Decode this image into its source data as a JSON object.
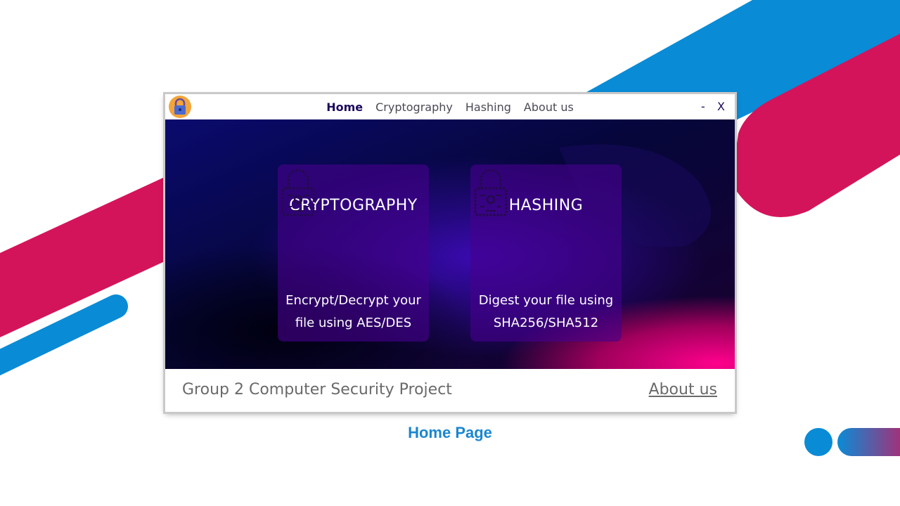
{
  "nav": {
    "items": [
      {
        "label": "Home",
        "active": true
      },
      {
        "label": "Cryptography",
        "active": false
      },
      {
        "label": "Hashing",
        "active": false
      },
      {
        "label": "About us",
        "active": false
      }
    ]
  },
  "window_controls": {
    "minimize": "-",
    "close": "X"
  },
  "app_icon": "lock-icon",
  "cards": [
    {
      "title": "CRYPTOGRAPHY",
      "icon": "padlock-icon",
      "description": "Encrypt/Decrypt your file using AES/DES"
    },
    {
      "title": "HASHING",
      "icon": "padlock-icon",
      "description": "Digest your file using SHA256/SHA512"
    }
  ],
  "footer": {
    "title": "Group 2 Computer Security Project",
    "link": "About us"
  },
  "caption": "Home Page",
  "colors": {
    "accent_blue": "#0a8bd6",
    "accent_pink": "#d4145a",
    "nav_active": "#1c0a5c",
    "card_bg": "#46008c"
  }
}
